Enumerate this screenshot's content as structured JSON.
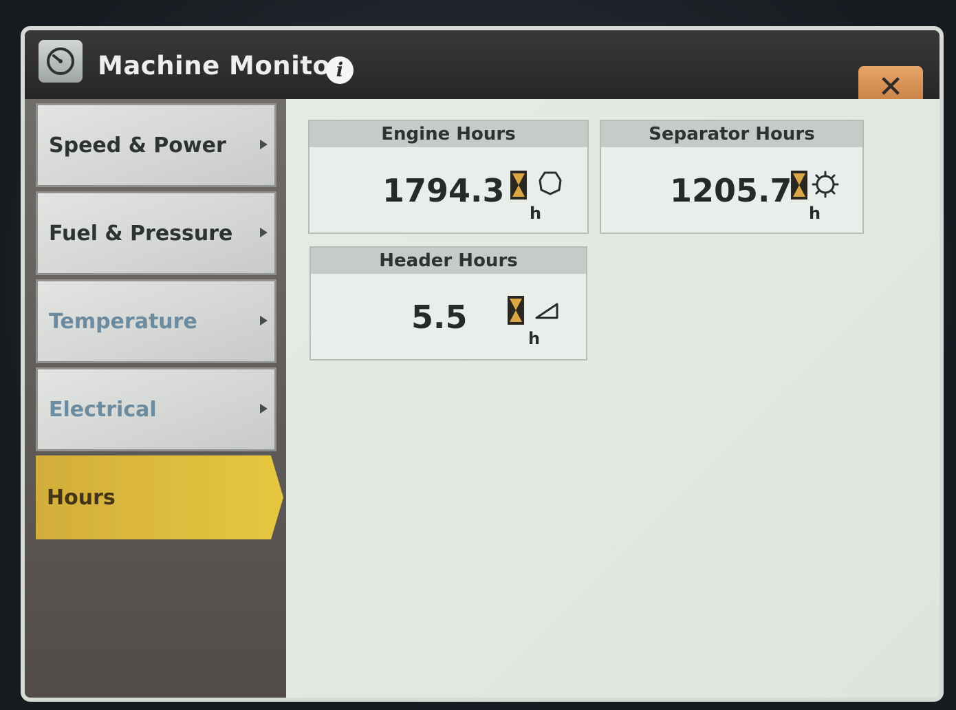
{
  "header": {
    "title": "Machine Monitor",
    "info_glyph": "i",
    "close_glyph": "✕"
  },
  "sidebar": {
    "items": [
      {
        "label": "Speed & Power"
      },
      {
        "label": "Fuel & Pressure"
      },
      {
        "label": "Temperature"
      },
      {
        "label": "Electrical"
      },
      {
        "label": "Hours"
      }
    ]
  },
  "cards": {
    "engine": {
      "title": "Engine Hours",
      "value": "1794.3",
      "unit": "h"
    },
    "separator": {
      "title": "Separator Hours",
      "value": "1205.7",
      "unit": "h"
    },
    "header": {
      "title": "Header Hours",
      "value": "5.5",
      "unit": "h"
    }
  },
  "colors": {
    "active_tab": "#e6c63f",
    "close_button": "#d98f52",
    "hourglass": "#d9a743"
  }
}
